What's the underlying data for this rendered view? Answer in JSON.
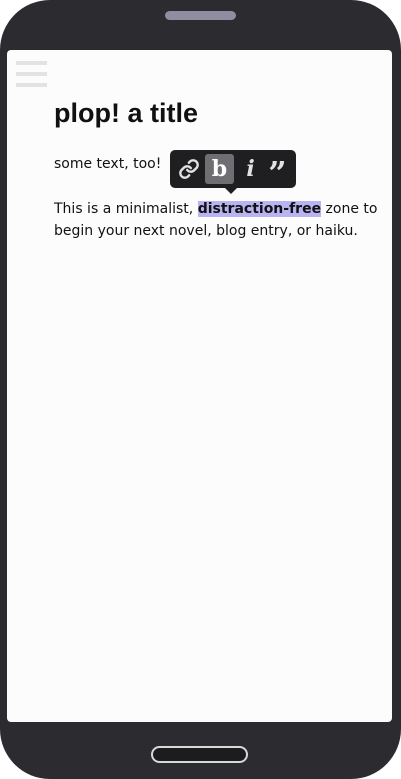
{
  "editor": {
    "title": "plop! a title",
    "line1": "some text, too!",
    "paragraph": {
      "before": "This is a minimalist, ",
      "highlight": "distraction-free",
      "after": " zone to begin your next novel, blog entry, or haiku."
    }
  },
  "toolbar": {
    "bold_label": "b",
    "italic_label": "i",
    "quote_label": "”"
  },
  "icons": [
    "menu-icon",
    "link-icon"
  ],
  "colors": {
    "phone_body": "#2b2b30",
    "screen_bg": "#fcfcfc",
    "selection_highlight": "#b9b3f2",
    "toolbar_bg": "#1f1f22",
    "active_button": "#6f6f73"
  }
}
